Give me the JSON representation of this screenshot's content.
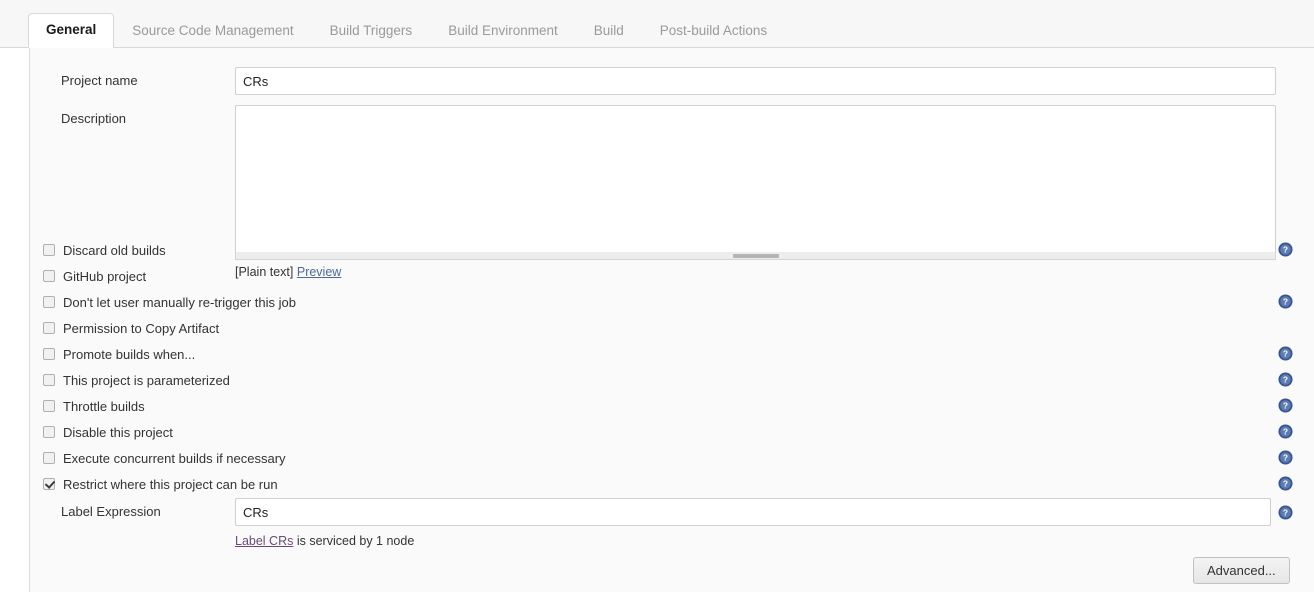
{
  "tabs": [
    {
      "label": "General",
      "active": true
    },
    {
      "label": "Source Code Management",
      "active": false
    },
    {
      "label": "Build Triggers",
      "active": false
    },
    {
      "label": "Build Environment",
      "active": false
    },
    {
      "label": "Build",
      "active": false
    },
    {
      "label": "Post-build Actions",
      "active": false
    }
  ],
  "form": {
    "project_name": {
      "label": "Project name",
      "value": "CRs",
      "placeholder": ""
    },
    "description": {
      "label": "Description",
      "value": "",
      "placeholder": "",
      "markup_note": "[Plain text]",
      "preview_link": "Preview"
    },
    "label_expression": {
      "label": "Label Expression",
      "value": "CRs",
      "placeholder": "",
      "node_link": "Label CRs",
      "node_text": " is serviced by 1 node"
    }
  },
  "checkboxes": [
    {
      "label": "Discard old builds",
      "checked": false,
      "help": true
    },
    {
      "label": "GitHub project",
      "checked": false,
      "help": false
    },
    {
      "label": "Don't let user manually re-trigger this job",
      "checked": false,
      "help": true
    },
    {
      "label": "Permission to Copy Artifact",
      "checked": false,
      "help": false
    },
    {
      "label": "Promote builds when...",
      "checked": false,
      "help": true
    },
    {
      "label": "This project is parameterized",
      "checked": false,
      "help": true
    },
    {
      "label": "Throttle builds",
      "checked": false,
      "help": true
    },
    {
      "label": "Disable this project",
      "checked": false,
      "help": true
    },
    {
      "label": "Execute concurrent builds if necessary",
      "checked": false,
      "help": true
    },
    {
      "label": "Restrict where this project can be run",
      "checked": true,
      "help": true
    }
  ],
  "buttons": {
    "advanced": "Advanced..."
  },
  "icons": {
    "help": "help-question-icon"
  },
  "colors": {
    "help_icon": "#36548f",
    "link": "#4a6b9a",
    "panel_bg": "#fafafa",
    "tabbar_bg": "#f7f7f7",
    "active_tab_bg": "#ffffff"
  }
}
